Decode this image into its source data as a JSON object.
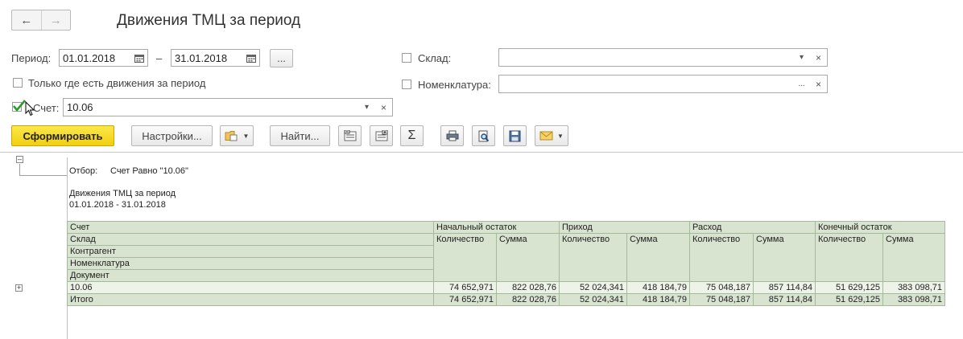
{
  "window": {
    "title": "Движения ТМЦ за период"
  },
  "filters": {
    "period_label": "Период:",
    "date_from": "01.01.2018",
    "date_sep": "–",
    "date_to": "31.01.2018",
    "more_label": "...",
    "only_movements_label": "Только где есть движения за период",
    "account_label": "Счет:",
    "account_value": "10.06",
    "account_checked": true,
    "warehouse_label": "Склад:",
    "warehouse_value": "",
    "nomenclature_label": "Номенклатура:",
    "nomenclature_value": ""
  },
  "toolbar": {
    "generate_label": "Сформировать",
    "settings_label": "Настройки...",
    "find_label": "Найти...",
    "sum_icon": "Σ"
  },
  "report": {
    "filter_label": "Отбор:",
    "filter_value": "Счет Равно \"10.06\"",
    "title": "Движения ТМЦ за период",
    "period": "01.01.2018 - 31.01.2018",
    "headers": {
      "account": "Счет",
      "warehouse": "Склад",
      "counterparty": "Контрагент",
      "nomenclature": "Номенклатура",
      "document": "Документ",
      "opening": "Начальный остаток",
      "receipt": "Приход",
      "expense": "Расход",
      "closing": "Конечный остаток",
      "qty": "Количество",
      "sum": "Сумма"
    },
    "rows": [
      {
        "name": "10.06",
        "values": [
          "74 652,971",
          "822 028,76",
          "52 024,341",
          "418 184,79",
          "75 048,187",
          "857 114,84",
          "51 629,125",
          "383 098,71"
        ]
      }
    ],
    "total": {
      "name": "Итого",
      "values": [
        "74 652,971",
        "822 028,76",
        "52 024,341",
        "418 184,79",
        "75 048,187",
        "857 114,84",
        "51 629,125",
        "383 098,71"
      ]
    }
  }
}
